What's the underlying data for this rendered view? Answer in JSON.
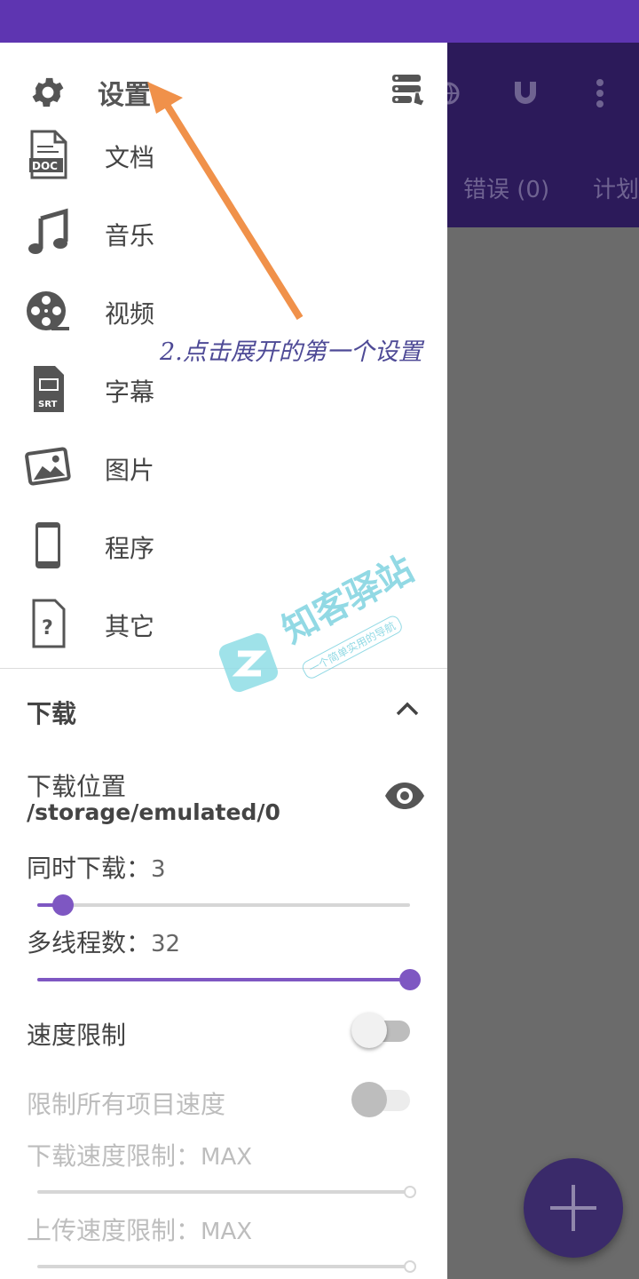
{
  "background_app": {
    "tabs": [
      "错误 (0)",
      "计划"
    ],
    "icons": [
      "globe-icon",
      "magnet-icon",
      "more-vert-icon"
    ]
  },
  "drawer": {
    "header_title": "设置",
    "categories": [
      {
        "label": "文档",
        "icon": "doc-file-icon"
      },
      {
        "label": "音乐",
        "icon": "music-note-icon"
      },
      {
        "label": "视频",
        "icon": "film-reel-icon"
      },
      {
        "label": "字幕",
        "icon": "srt-file-icon"
      },
      {
        "label": "图片",
        "icon": "picture-icon"
      },
      {
        "label": "程序",
        "icon": "phone-icon"
      },
      {
        "label": "其它",
        "icon": "unknown-file-icon"
      }
    ],
    "download_section": {
      "title": "下载",
      "location_label": "下载位置",
      "location_path": "/storage/emulated/0",
      "concurrent_label": "同时下载：",
      "concurrent_value": "3",
      "concurrent_fraction": 0.07,
      "threads_label": "多线程数：",
      "threads_value": "32",
      "threads_fraction": 1.0,
      "speed_limit_label": "速度限制",
      "speed_limit_on": false,
      "limit_all_label": "限制所有项目速度",
      "limit_all_on": false,
      "download_limit_label": "下载速度限制：",
      "download_limit_value": "MAX",
      "upload_limit_label": "上传速度限制：",
      "upload_limit_value": "MAX"
    }
  },
  "annotation": {
    "text": "2.点击展开的第一个设置",
    "color": "#f0914a"
  },
  "watermark": {
    "title": "知客驿站",
    "subtitle": "一个简单实用的导航"
  },
  "colors": {
    "status_bar": "#5e35b1",
    "accent": "#7e57c2",
    "dim_overlay": "#6b6b6b"
  }
}
